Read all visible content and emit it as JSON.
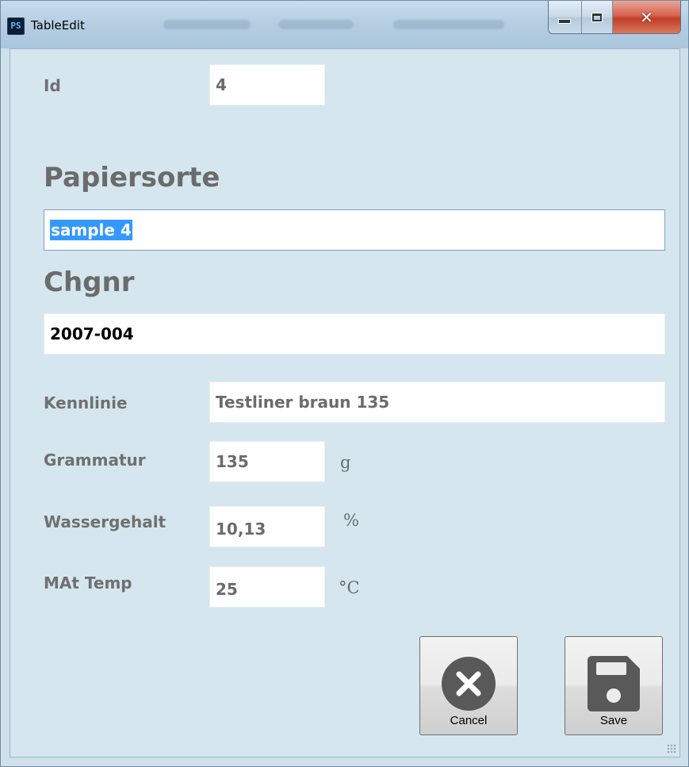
{
  "window": {
    "title": "TableEdit",
    "app_icon_text": "PS",
    "close_glyph": "✕"
  },
  "form": {
    "id_label": "Id",
    "id_value": "4",
    "papiersorte_label": "Papiersorte",
    "papiersorte_value": "sample 4",
    "chgnr_label": "Chgnr",
    "chgnr_value": "2007-004",
    "kennlinie_label": "Kennlinie",
    "kennlinie_value": "Testliner braun 135",
    "grammatur_label": "Grammatur",
    "grammatur_value": "135",
    "grammatur_unit": "g",
    "wassergehalt_label": "Wassergehalt",
    "wassergehalt_value": "10,13",
    "wassergehalt_unit": "%",
    "mattemp_label": "MAt Temp",
    "mattemp_value": "25",
    "mattemp_unit": "°C"
  },
  "buttons": {
    "cancel_label": "Cancel",
    "save_label": "Save",
    "cancel_icon": "cancel-icon",
    "save_icon": "floppy-disk-icon"
  },
  "colors": {
    "background": "#d5e6ef",
    "label_gray": "#707070",
    "selection": "#3399ff",
    "icon_gray": "#595959"
  }
}
